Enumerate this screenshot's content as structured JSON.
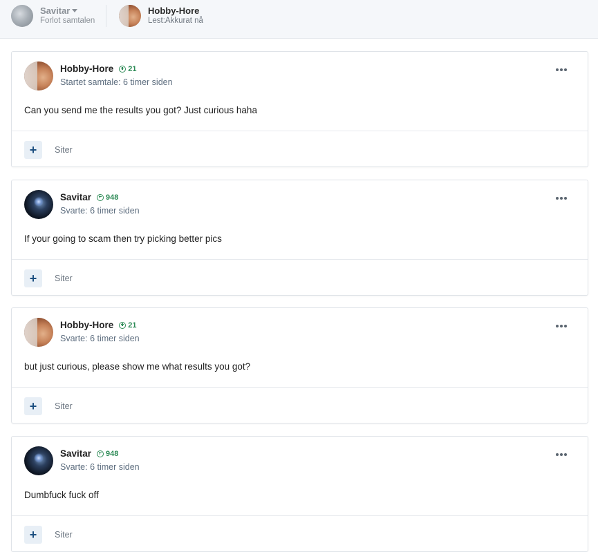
{
  "participants": [
    {
      "name": "Savitar",
      "status": "Forlot samtalen",
      "avatar": "savitar-grey-avatar"
    },
    {
      "name": "Hobby-Hore",
      "status": "Lest:Akkurat nå",
      "avatar": "hobby-hore-avatar"
    }
  ],
  "posts": [
    {
      "author": "Hobby-Hore",
      "reputation": "21",
      "meta": "Startet samtale: 6 timer siden",
      "body": "Can you send me the results you got? Just curious haha",
      "quote_label": "Siter"
    },
    {
      "author": "Savitar",
      "reputation": "948",
      "meta": "Svarte: 6 timer siden",
      "body": "If your going to scam then try picking better pics",
      "quote_label": "Siter"
    },
    {
      "author": "Hobby-Hore",
      "reputation": "21",
      "meta": "Svarte: 6 timer siden",
      "body": "but just curious, please show me what results you got?",
      "quote_label": "Siter"
    },
    {
      "author": "Savitar",
      "reputation": "948",
      "meta": "Svarte: 6 timer siden",
      "body": "Dumbfuck fuck off",
      "quote_label": "Siter"
    }
  ],
  "colors": {
    "reputation": "#2e8b57",
    "quote_button_bg": "#e8eff6",
    "meta_text": "#5f6f80"
  }
}
